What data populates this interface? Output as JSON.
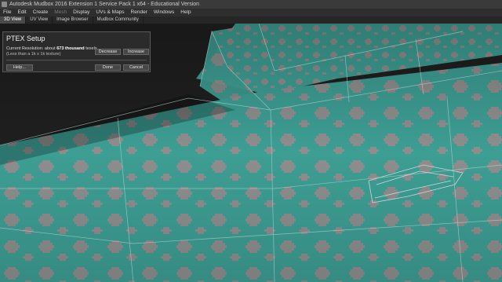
{
  "window": {
    "title": "Autodesk Mudbox 2016 Extension 1 Service Pack 1 x64 - Educational Version"
  },
  "menu": {
    "items": [
      {
        "label": "File"
      },
      {
        "label": "Edit"
      },
      {
        "label": "Create"
      },
      {
        "label": "Mesh"
      },
      {
        "label": "Display"
      },
      {
        "label": "UVs & Maps"
      },
      {
        "label": "Render"
      },
      {
        "label": "Windows"
      },
      {
        "label": "Help"
      }
    ]
  },
  "tabs": [
    {
      "label": "3D View"
    },
    {
      "label": "UV View"
    },
    {
      "label": "Image Browser"
    },
    {
      "label": "Mudbox Community"
    }
  ],
  "dialog": {
    "title": "PTEX Setup",
    "resolution_prefix": "Current Resolution: about ",
    "resolution_value": "673 thousand",
    "resolution_suffix": " texels",
    "note": "(Less than a 1k x 1k texture)",
    "decrease_label": "Decrease",
    "increase_label": "Increase",
    "help_label": "Help...",
    "done_label": "Done",
    "cancel_label": "Cancel"
  },
  "colors": {
    "mesh_teal": "#3d9e94",
    "pattern_gray": "#8e8e8e",
    "wire": "#b9d3cf",
    "background": "#1f1f1f"
  }
}
